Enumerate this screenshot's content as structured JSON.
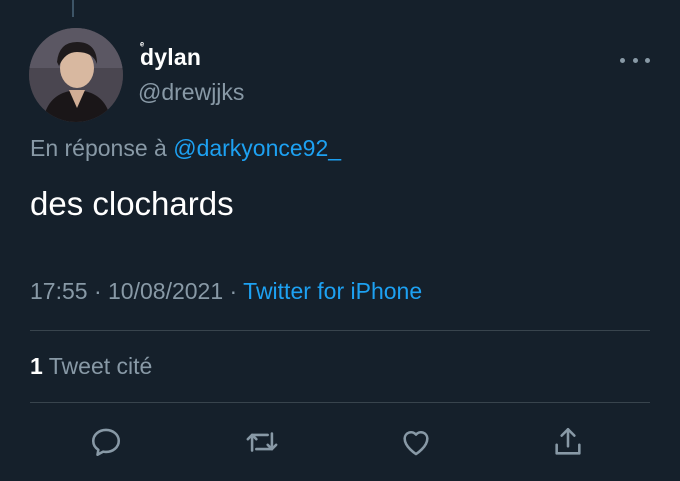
{
  "tweet": {
    "author_name": "dylan",
    "author_name_mark": "ᵉ",
    "handle": "@drewjjks",
    "reply_prefix": "En réponse à",
    "reply_mention": "@darkyonce92_",
    "text": "des clochards",
    "time": "17:55",
    "separator": " · ",
    "date": "10/08/2021",
    "source": "Twitter for iPhone",
    "quote_count": "1",
    "quote_label": "Tweet cité"
  },
  "icons": {
    "more": "more-horizontal-icon",
    "reply": "reply-icon",
    "retweet": "retweet-icon",
    "like": "heart-icon",
    "share": "share-icon"
  },
  "colors": {
    "background": "#15202b",
    "secondary_text": "#8899a6",
    "link": "#1da1f2",
    "divider": "#38444d"
  }
}
